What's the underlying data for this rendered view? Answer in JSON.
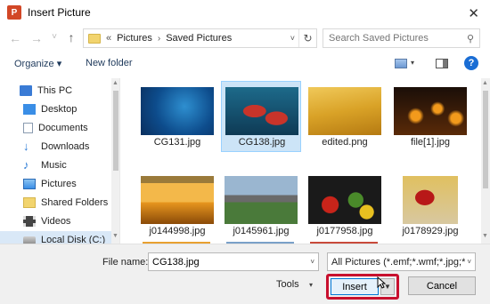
{
  "window": {
    "title": "Insert Picture",
    "app_icon_letter": "P",
    "close_glyph": "✕"
  },
  "nav": {
    "back_glyph": "←",
    "forward_glyph": "→",
    "dropdown_glyph": "˅",
    "up_glyph": "↑",
    "address_prefix": "«",
    "breadcrumb": [
      "Pictures",
      "Saved Pictures"
    ],
    "separator": "›",
    "address_drop_glyph": "˅",
    "refresh_glyph": "↻",
    "search_placeholder": "Search Saved Pictures",
    "search_glyph": "⚲"
  },
  "toolbar": {
    "organize": "Organize ▾",
    "new_folder": "New folder",
    "view_drop_glyph": "▾",
    "help": "?"
  },
  "sidebar": {
    "items": [
      {
        "label": "This PC",
        "icon": "computer-icon",
        "color": "#3a7bd5"
      },
      {
        "label": "Desktop",
        "icon": "desktop-icon",
        "color": "#3a8ee6"
      },
      {
        "label": "Documents",
        "icon": "documents-icon",
        "color": "#8a9bb0"
      },
      {
        "label": "Downloads",
        "icon": "downloads-icon",
        "color": "#2a7ad5"
      },
      {
        "label": "Music",
        "icon": "music-icon",
        "color": "#2a7ad5"
      },
      {
        "label": "Pictures",
        "icon": "pictures-icon",
        "color": "#5aa0e8"
      },
      {
        "label": "Shared Folders",
        "icon": "folder-icon",
        "color": "#f2d46e"
      },
      {
        "label": "Videos",
        "icon": "videos-icon",
        "color": "#444"
      },
      {
        "label": "Local Disk (C:)",
        "icon": "disk-icon",
        "color": "#8a8a8a"
      }
    ],
    "selected_index": 8
  },
  "files": [
    {
      "name": "CG131.jpg",
      "colors": [
        "#0d4c8c",
        "#2e8fd0",
        "#0a2f5e"
      ],
      "selected": false
    },
    {
      "name": "CG138.jpg",
      "colors": [
        "#1d6a8a",
        "#c8342a",
        "#0e3a55"
      ],
      "selected": true
    },
    {
      "name": "edited.png",
      "colors": [
        "#d9a227",
        "#f0c95a",
        "#b57a12"
      ],
      "selected": false
    },
    {
      "name": "file[1].jpg",
      "colors": [
        "#1a0e08",
        "#f29a1c",
        "#5a2a08"
      ],
      "selected": false
    },
    {
      "name": "j0144998.jpg",
      "colors": [
        "#e8961f",
        "#f3b84a",
        "#8a4a08"
      ],
      "selected": false
    },
    {
      "name": "j0145961.jpg",
      "colors": [
        "#9ab6d0",
        "#4a7a3a",
        "#6a6a6a"
      ],
      "selected": false
    },
    {
      "name": "j0177958.jpg",
      "colors": [
        "#1a1a1a",
        "#c8241a",
        "#4a8a2a"
      ],
      "selected": false
    },
    {
      "name": "j0178929.jpg",
      "colors": [
        "#e0c060",
        "#b81818",
        "#d8c8a0"
      ],
      "selected": false
    }
  ],
  "footer": {
    "file_name_label": "File name:",
    "file_name_value": "CG138.jpg",
    "filter_value": "All Pictures (*.emf;*.wmf;*.jpg;*",
    "dropdown_glyph": "˅",
    "tools_label": "Tools",
    "tools_glyph": "▾",
    "insert_label": "Insert",
    "insert_drop_glyph": "▼",
    "cancel_label": "Cancel"
  }
}
